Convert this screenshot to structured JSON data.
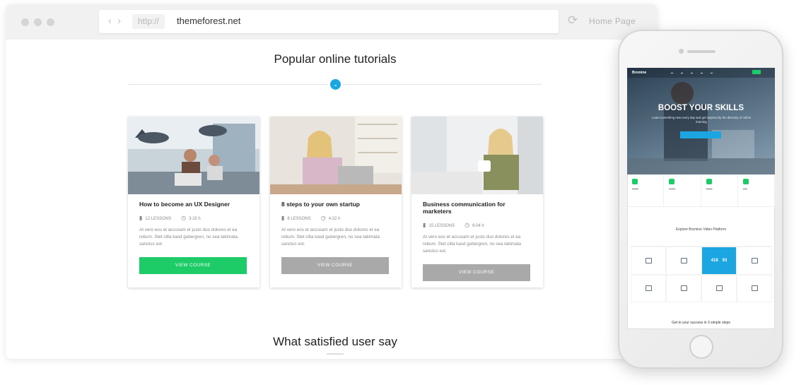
{
  "browser": {
    "protocol": "http://",
    "url": "themeforest.net",
    "home_label": "Home Page"
  },
  "page": {
    "section_title": "Popular online tutorials",
    "bottom_title": "What satisfied user say"
  },
  "courses": [
    {
      "title": "How to become an UX Designer",
      "lessons": "12 LESSONS",
      "duration": "3:15 h",
      "description": "At vero eos et accusam et justo duo dolores et ea rebum. Stet clita kasd gubergren, no sea takimata sanctus est.",
      "cta": "VIEW COURSE",
      "cta_color": "#1dcc66"
    },
    {
      "title": "8 steps to your own startup",
      "lessons": "8 LESSONS",
      "duration": "4:22 h",
      "description": "At vero eos et accusam et justo duo dolores et ea rebum. Stet clita kasd gubergren, no sea takimata sanctus est.",
      "cta": "VIEW COURSE",
      "cta_color": "#a9a9a9"
    },
    {
      "title": "Business communication for marketers",
      "lessons": "15 LESSONS",
      "duration": "6:04 h",
      "description": "At vero eos et accusam et justo duo dolores et ea rebum. Stet clita kasd gubergren, no sea takimata sanctus est.",
      "cta": "VIEW COURSE",
      "cta_color": "#a9a9a9"
    }
  ],
  "phone": {
    "logo": "Bromine",
    "hero_title": "BOOST YOUR SKILLS",
    "hero_sub": "Learn something new every day and get inspired by the diversity of online learning",
    "explore_title": "Explore Bromine Video Platform",
    "stats": [
      "418",
      "93"
    ],
    "steps_title": "Get to your success in 3 simple steps"
  },
  "colors": {
    "accent_blue": "#1ba6e2",
    "accent_green": "#1dcc66",
    "button_gray": "#a9a9a9"
  }
}
